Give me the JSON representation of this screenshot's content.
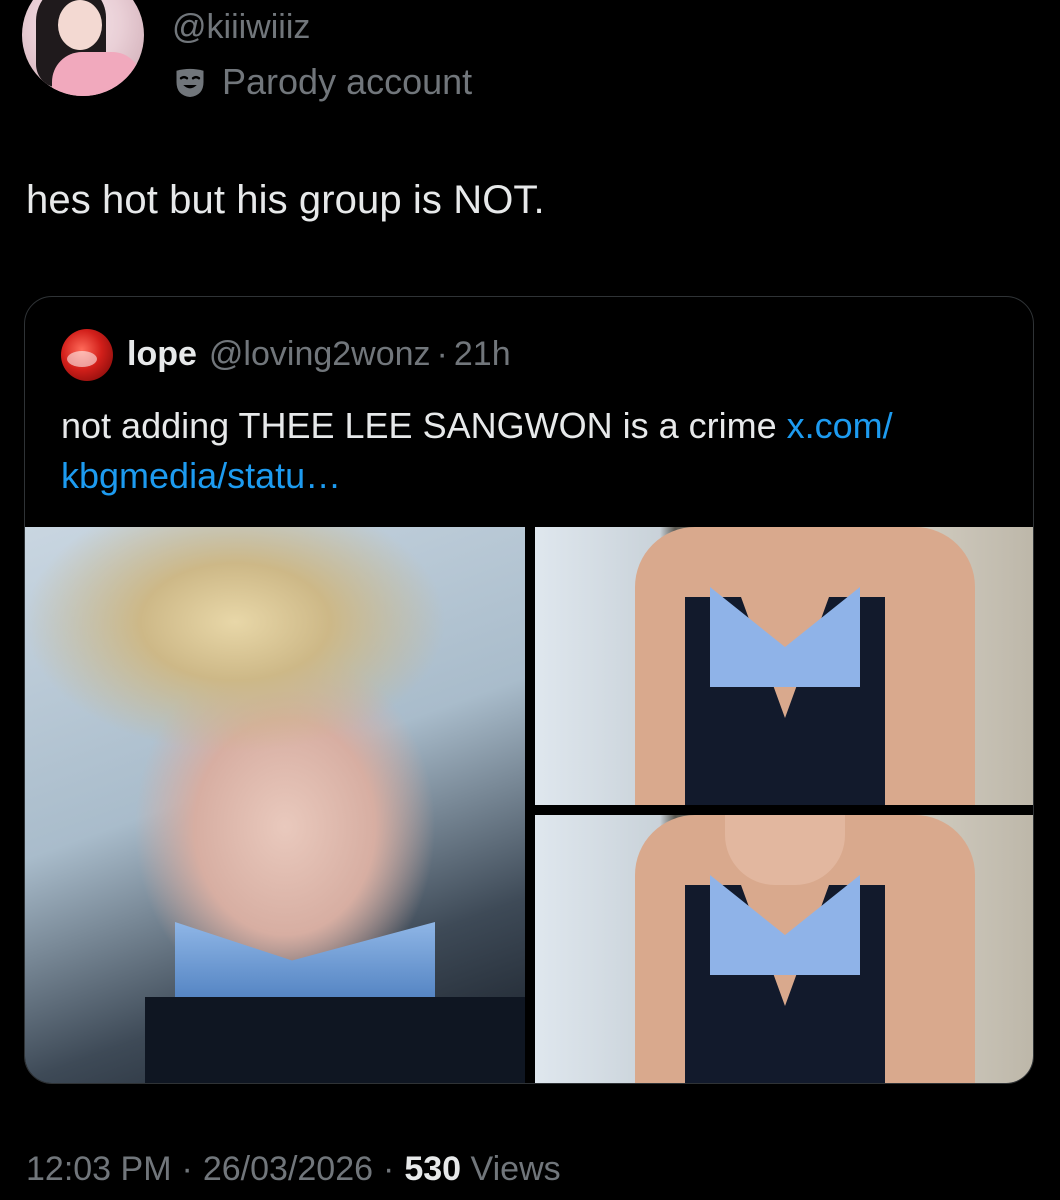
{
  "author": {
    "handle": "@kiiiwiiiz",
    "label": "Parody account",
    "label_icon": "parody-mask-icon"
  },
  "tweet": {
    "text": "hes hot but his group is NOT."
  },
  "quoted": {
    "name": "lope",
    "handle": "@loving2wonz",
    "separator": "·",
    "time": "21h",
    "text": "not adding THEE LEE SANGWON is a crime ",
    "link": "x.com/ kbgmedia/statu…"
  },
  "footer": {
    "time": "12:03 PM",
    "separator": "·",
    "date": "26/03/2026",
    "views_count": "530",
    "views_label": "Views"
  },
  "colors": {
    "background": "#000000",
    "text": "#e7e9ea",
    "muted": "#71767b",
    "link": "#1d9bf0",
    "border": "#2f3336"
  }
}
